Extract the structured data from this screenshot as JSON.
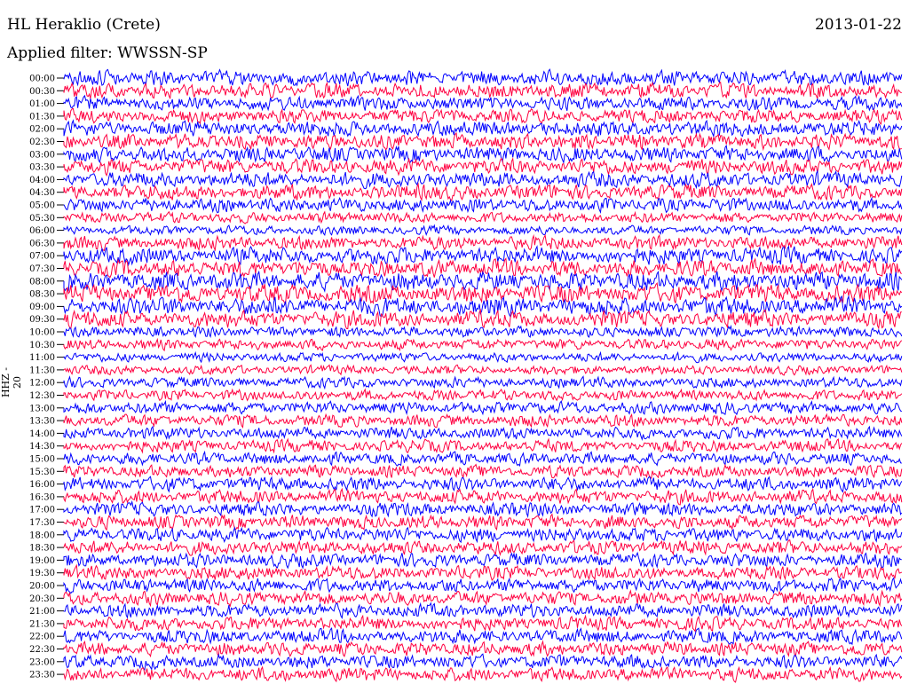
{
  "header": {
    "station": "HL Heraklio (Crete)",
    "date": "2013-01-22",
    "filter": "Applied filter: WWSSN-SP",
    "channel": "HHZ - 20"
  },
  "chart_data": {
    "type": "line",
    "title": "HL Heraklio (Crete)",
    "xlabel": "",
    "ylabel": "HHZ - 20",
    "y_tick_labels": [
      "00:00",
      "00:30",
      "01:00",
      "01:30",
      "02:00",
      "02:30",
      "03:00",
      "03:30",
      "04:00",
      "04:30",
      "05:00",
      "05:30",
      "06:00",
      "06:30",
      "07:00",
      "07:30",
      "08:00",
      "08:30",
      "09:00",
      "09:30",
      "10:00",
      "10:30",
      "11:00",
      "11:30",
      "12:00",
      "12:30",
      "13:00",
      "13:30",
      "14:00",
      "14:30",
      "15:00",
      "15:30",
      "16:00",
      "16:30",
      "17:00",
      "17:30",
      "18:00",
      "18:30",
      "19:00",
      "19:30",
      "20:00",
      "20:30",
      "21:00",
      "21:30",
      "22:00",
      "22:30",
      "23:00",
      "23:30"
    ],
    "trace_colors": [
      "#0000ff",
      "#ff0040"
    ],
    "amplitude_by_row": [
      1.0,
      1.0,
      0.9,
      0.9,
      1.0,
      1.0,
      1.0,
      1.0,
      1.0,
      1.0,
      0.9,
      0.7,
      0.6,
      0.9,
      1.1,
      1.1,
      1.2,
      1.2,
      1.2,
      1.1,
      0.7,
      0.7,
      0.6,
      0.6,
      0.7,
      0.7,
      0.8,
      0.8,
      0.8,
      0.8,
      0.8,
      0.8,
      0.9,
      0.9,
      0.9,
      0.9,
      0.9,
      0.9,
      0.9,
      0.9,
      0.9,
      0.9,
      0.9,
      0.9,
      0.9,
      0.9,
      0.9,
      0.9
    ],
    "grid": false,
    "legend": "none"
  }
}
